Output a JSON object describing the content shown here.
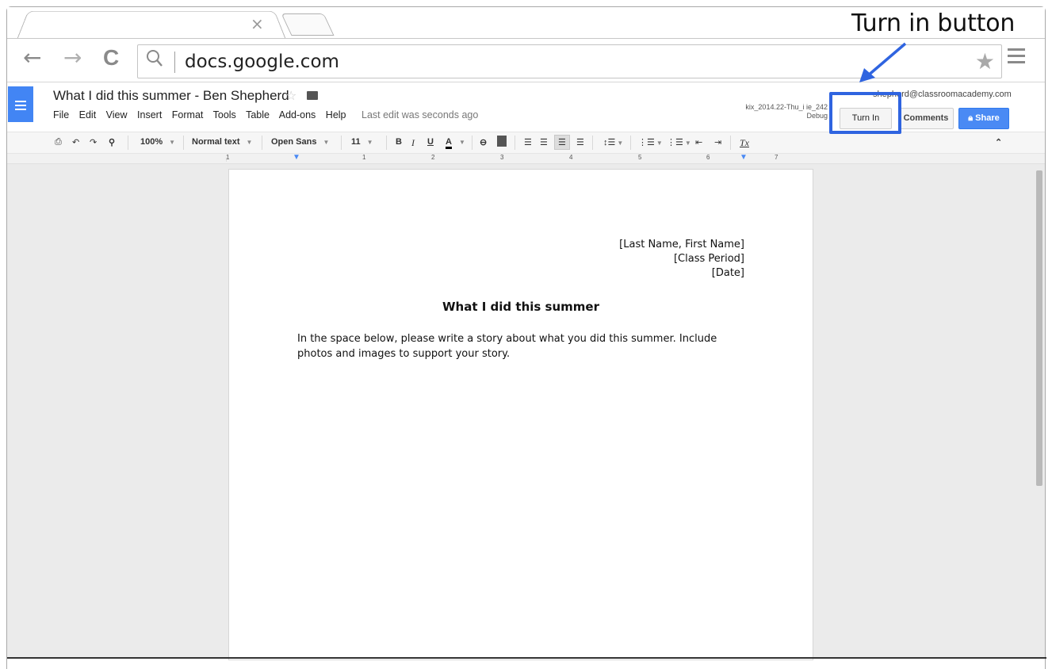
{
  "annotation": {
    "label": "Turn in button"
  },
  "browser": {
    "tab_close": "×",
    "url": "docs.google.com",
    "back": "←",
    "forward": "→",
    "reload": "C"
  },
  "doc": {
    "title": "What I did this summer - Ben Shepherd",
    "menus": [
      "File",
      "Edit",
      "View",
      "Insert",
      "Format",
      "Tools",
      "Table",
      "Add-ons",
      "Help"
    ],
    "last_edit": "Last edit was seconds ago",
    "account": "shepherd@classroomacademy.com",
    "build_line1": "kix_2014.22-Thu_i ie_242",
    "build_line2": "Debug",
    "turn_in_label": "Turn In",
    "comments_label": "Comments",
    "share_label": "Share"
  },
  "format_toolbar": {
    "zoom": "100%",
    "style": "Normal text",
    "font": "Open Sans",
    "size": "11",
    "bold": "B",
    "italic": "I",
    "underline": "U",
    "text_color": "A",
    "clear_format": "Tx"
  },
  "ruler": {
    "numbers": [
      "1",
      "1",
      "2",
      "3",
      "4",
      "5",
      "6",
      "7"
    ]
  },
  "document": {
    "name_line": "[Last Name, First Name]",
    "period_line": "[Class Period]",
    "date_line": "[Date]",
    "heading": "What I did this summer",
    "body": "In the space below, please write a story about what you did this summer. Include photos and images to support your story."
  },
  "colors": {
    "accent_blue": "#4285f4",
    "annotation_blue": "#2f64e0",
    "share_blue": "#4a8af4"
  }
}
